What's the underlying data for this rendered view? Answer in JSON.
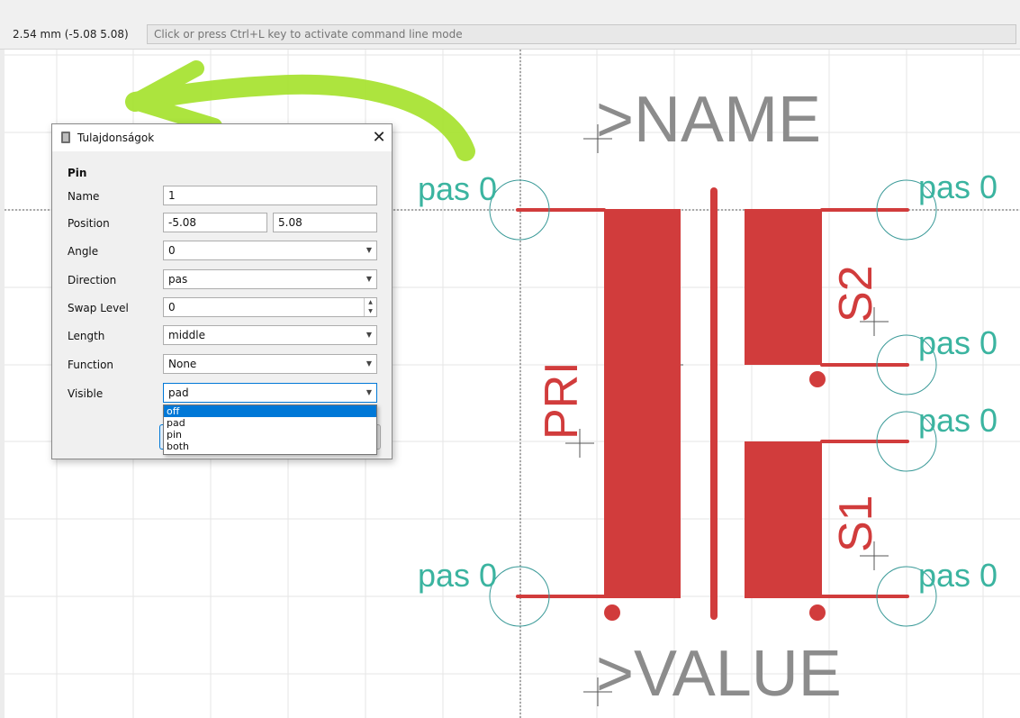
{
  "statusbar": {
    "coordinates": "2.54 mm (-5.08 5.08)",
    "command_placeholder": "Click or press Ctrl+L key to activate command line mode"
  },
  "canvas": {
    "name_label": ">NAME",
    "value_label": ">VALUE",
    "primary_label": "PRI",
    "secondary1_label": "S1",
    "secondary2_label": "S2",
    "pin_label": "pas 0",
    "colors": {
      "symbol": "#d13c3c",
      "pin_text": "#3bb4a0",
      "name_text": "#8c8c8c",
      "pin_circle": "#3a9a98",
      "grid": "#e5e5e5",
      "annotation": "#a6e22e"
    }
  },
  "dialog": {
    "title": "Tulajdonságok",
    "section": "Pin",
    "fields": {
      "name": {
        "label": "Name",
        "value": "1"
      },
      "position": {
        "label": "Position",
        "x": "-5.08",
        "y": "5.08"
      },
      "angle": {
        "label": "Angle",
        "value": "0"
      },
      "direction": {
        "label": "Direction",
        "value": "pas"
      },
      "swap_level": {
        "label": "Swap Level",
        "value": "0"
      },
      "length": {
        "label": "Length",
        "value": "middle"
      },
      "function": {
        "label": "Function",
        "value": "None"
      },
      "visible": {
        "label": "Visible",
        "value": "pad"
      }
    },
    "visible_options": [
      "off",
      "pad",
      "pin",
      "both"
    ],
    "highlighted_option": "off"
  }
}
